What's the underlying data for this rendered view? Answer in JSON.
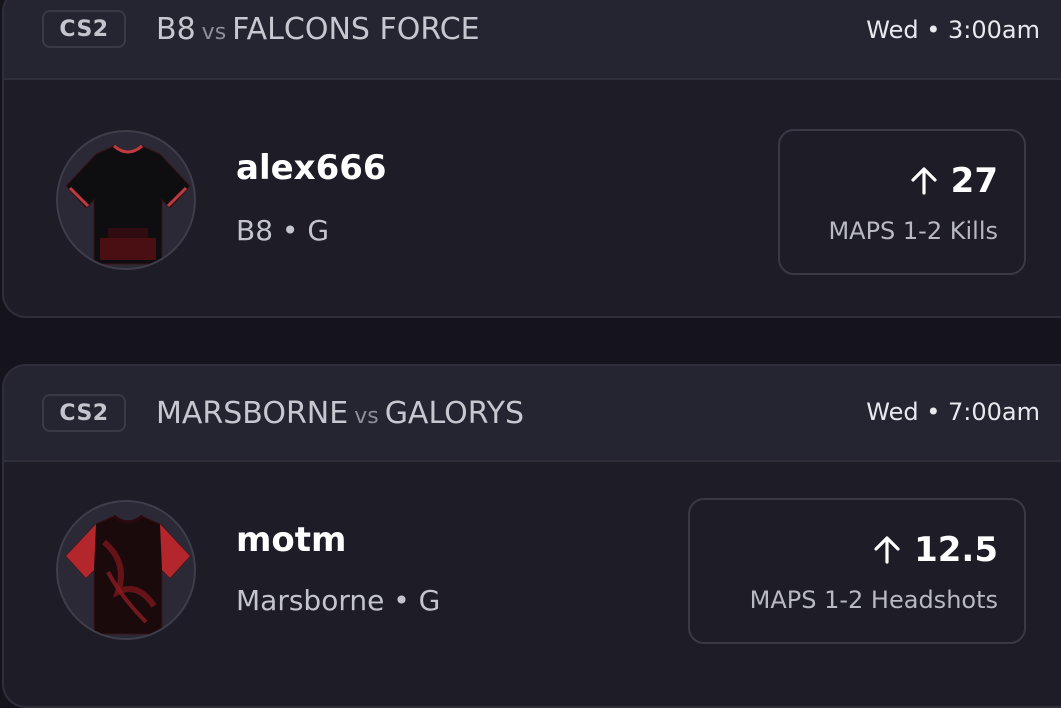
{
  "cards": [
    {
      "game": "CS2",
      "team_a": "B8",
      "vs": "vs",
      "team_b": "FALCONS FORCE",
      "time": "Wed • 3:00am",
      "player": {
        "name": "alex666",
        "meta": "B8 • G",
        "jersey_icon": "jersey-black-icon"
      },
      "stat": {
        "direction": "up",
        "value": "27",
        "label": "MAPS 1-2 Kills"
      }
    },
    {
      "game": "CS2",
      "team_a": "MARSBORNE",
      "vs": "vs",
      "team_b": "GALORYS",
      "time": "Wed • 7:00am",
      "player": {
        "name": "motm",
        "meta": "Marsborne • G",
        "jersey_icon": "jersey-red-icon"
      },
      "stat": {
        "direction": "up",
        "value": "12.5",
        "label": "MAPS 1-2 Headshots"
      }
    }
  ],
  "colors": {
    "background": "#15141d",
    "card": "#1d1c27",
    "header": "#252431",
    "border": "#2f2e3b",
    "jersey_accent": "#b3262b"
  }
}
